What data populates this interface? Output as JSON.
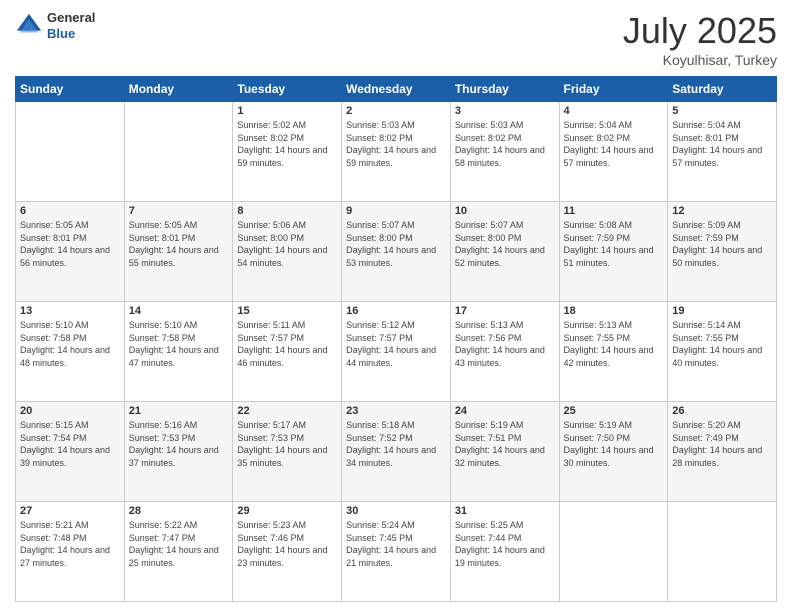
{
  "logo": {
    "general": "General",
    "blue": "Blue"
  },
  "header": {
    "month": "July 2025",
    "location": "Koyulhisar, Turkey"
  },
  "days_of_week": [
    "Sunday",
    "Monday",
    "Tuesday",
    "Wednesday",
    "Thursday",
    "Friday",
    "Saturday"
  ],
  "weeks": [
    [
      {
        "day": "",
        "sunrise": "",
        "sunset": "",
        "daylight": ""
      },
      {
        "day": "",
        "sunrise": "",
        "sunset": "",
        "daylight": ""
      },
      {
        "day": "1",
        "sunrise": "Sunrise: 5:02 AM",
        "sunset": "Sunset: 8:02 PM",
        "daylight": "Daylight: 14 hours and 59 minutes."
      },
      {
        "day": "2",
        "sunrise": "Sunrise: 5:03 AM",
        "sunset": "Sunset: 8:02 PM",
        "daylight": "Daylight: 14 hours and 59 minutes."
      },
      {
        "day": "3",
        "sunrise": "Sunrise: 5:03 AM",
        "sunset": "Sunset: 8:02 PM",
        "daylight": "Daylight: 14 hours and 58 minutes."
      },
      {
        "day": "4",
        "sunrise": "Sunrise: 5:04 AM",
        "sunset": "Sunset: 8:02 PM",
        "daylight": "Daylight: 14 hours and 57 minutes."
      },
      {
        "day": "5",
        "sunrise": "Sunrise: 5:04 AM",
        "sunset": "Sunset: 8:01 PM",
        "daylight": "Daylight: 14 hours and 57 minutes."
      }
    ],
    [
      {
        "day": "6",
        "sunrise": "Sunrise: 5:05 AM",
        "sunset": "Sunset: 8:01 PM",
        "daylight": "Daylight: 14 hours and 56 minutes."
      },
      {
        "day": "7",
        "sunrise": "Sunrise: 5:05 AM",
        "sunset": "Sunset: 8:01 PM",
        "daylight": "Daylight: 14 hours and 55 minutes."
      },
      {
        "day": "8",
        "sunrise": "Sunrise: 5:06 AM",
        "sunset": "Sunset: 8:00 PM",
        "daylight": "Daylight: 14 hours and 54 minutes."
      },
      {
        "day": "9",
        "sunrise": "Sunrise: 5:07 AM",
        "sunset": "Sunset: 8:00 PM",
        "daylight": "Daylight: 14 hours and 53 minutes."
      },
      {
        "day": "10",
        "sunrise": "Sunrise: 5:07 AM",
        "sunset": "Sunset: 8:00 PM",
        "daylight": "Daylight: 14 hours and 52 minutes."
      },
      {
        "day": "11",
        "sunrise": "Sunrise: 5:08 AM",
        "sunset": "Sunset: 7:59 PM",
        "daylight": "Daylight: 14 hours and 51 minutes."
      },
      {
        "day": "12",
        "sunrise": "Sunrise: 5:09 AM",
        "sunset": "Sunset: 7:59 PM",
        "daylight": "Daylight: 14 hours and 50 minutes."
      }
    ],
    [
      {
        "day": "13",
        "sunrise": "Sunrise: 5:10 AM",
        "sunset": "Sunset: 7:58 PM",
        "daylight": "Daylight: 14 hours and 48 minutes."
      },
      {
        "day": "14",
        "sunrise": "Sunrise: 5:10 AM",
        "sunset": "Sunset: 7:58 PM",
        "daylight": "Daylight: 14 hours and 47 minutes."
      },
      {
        "day": "15",
        "sunrise": "Sunrise: 5:11 AM",
        "sunset": "Sunset: 7:57 PM",
        "daylight": "Daylight: 14 hours and 46 minutes."
      },
      {
        "day": "16",
        "sunrise": "Sunrise: 5:12 AM",
        "sunset": "Sunset: 7:57 PM",
        "daylight": "Daylight: 14 hours and 44 minutes."
      },
      {
        "day": "17",
        "sunrise": "Sunrise: 5:13 AM",
        "sunset": "Sunset: 7:56 PM",
        "daylight": "Daylight: 14 hours and 43 minutes."
      },
      {
        "day": "18",
        "sunrise": "Sunrise: 5:13 AM",
        "sunset": "Sunset: 7:55 PM",
        "daylight": "Daylight: 14 hours and 42 minutes."
      },
      {
        "day": "19",
        "sunrise": "Sunrise: 5:14 AM",
        "sunset": "Sunset: 7:55 PM",
        "daylight": "Daylight: 14 hours and 40 minutes."
      }
    ],
    [
      {
        "day": "20",
        "sunrise": "Sunrise: 5:15 AM",
        "sunset": "Sunset: 7:54 PM",
        "daylight": "Daylight: 14 hours and 39 minutes."
      },
      {
        "day": "21",
        "sunrise": "Sunrise: 5:16 AM",
        "sunset": "Sunset: 7:53 PM",
        "daylight": "Daylight: 14 hours and 37 minutes."
      },
      {
        "day": "22",
        "sunrise": "Sunrise: 5:17 AM",
        "sunset": "Sunset: 7:53 PM",
        "daylight": "Daylight: 14 hours and 35 minutes."
      },
      {
        "day": "23",
        "sunrise": "Sunrise: 5:18 AM",
        "sunset": "Sunset: 7:52 PM",
        "daylight": "Daylight: 14 hours and 34 minutes."
      },
      {
        "day": "24",
        "sunrise": "Sunrise: 5:19 AM",
        "sunset": "Sunset: 7:51 PM",
        "daylight": "Daylight: 14 hours and 32 minutes."
      },
      {
        "day": "25",
        "sunrise": "Sunrise: 5:19 AM",
        "sunset": "Sunset: 7:50 PM",
        "daylight": "Daylight: 14 hours and 30 minutes."
      },
      {
        "day": "26",
        "sunrise": "Sunrise: 5:20 AM",
        "sunset": "Sunset: 7:49 PM",
        "daylight": "Daylight: 14 hours and 28 minutes."
      }
    ],
    [
      {
        "day": "27",
        "sunrise": "Sunrise: 5:21 AM",
        "sunset": "Sunset: 7:48 PM",
        "daylight": "Daylight: 14 hours and 27 minutes."
      },
      {
        "day": "28",
        "sunrise": "Sunrise: 5:22 AM",
        "sunset": "Sunset: 7:47 PM",
        "daylight": "Daylight: 14 hours and 25 minutes."
      },
      {
        "day": "29",
        "sunrise": "Sunrise: 5:23 AM",
        "sunset": "Sunset: 7:46 PM",
        "daylight": "Daylight: 14 hours and 23 minutes."
      },
      {
        "day": "30",
        "sunrise": "Sunrise: 5:24 AM",
        "sunset": "Sunset: 7:45 PM",
        "daylight": "Daylight: 14 hours and 21 minutes."
      },
      {
        "day": "31",
        "sunrise": "Sunrise: 5:25 AM",
        "sunset": "Sunset: 7:44 PM",
        "daylight": "Daylight: 14 hours and 19 minutes."
      },
      {
        "day": "",
        "sunrise": "",
        "sunset": "",
        "daylight": ""
      },
      {
        "day": "",
        "sunrise": "",
        "sunset": "",
        "daylight": ""
      }
    ]
  ]
}
